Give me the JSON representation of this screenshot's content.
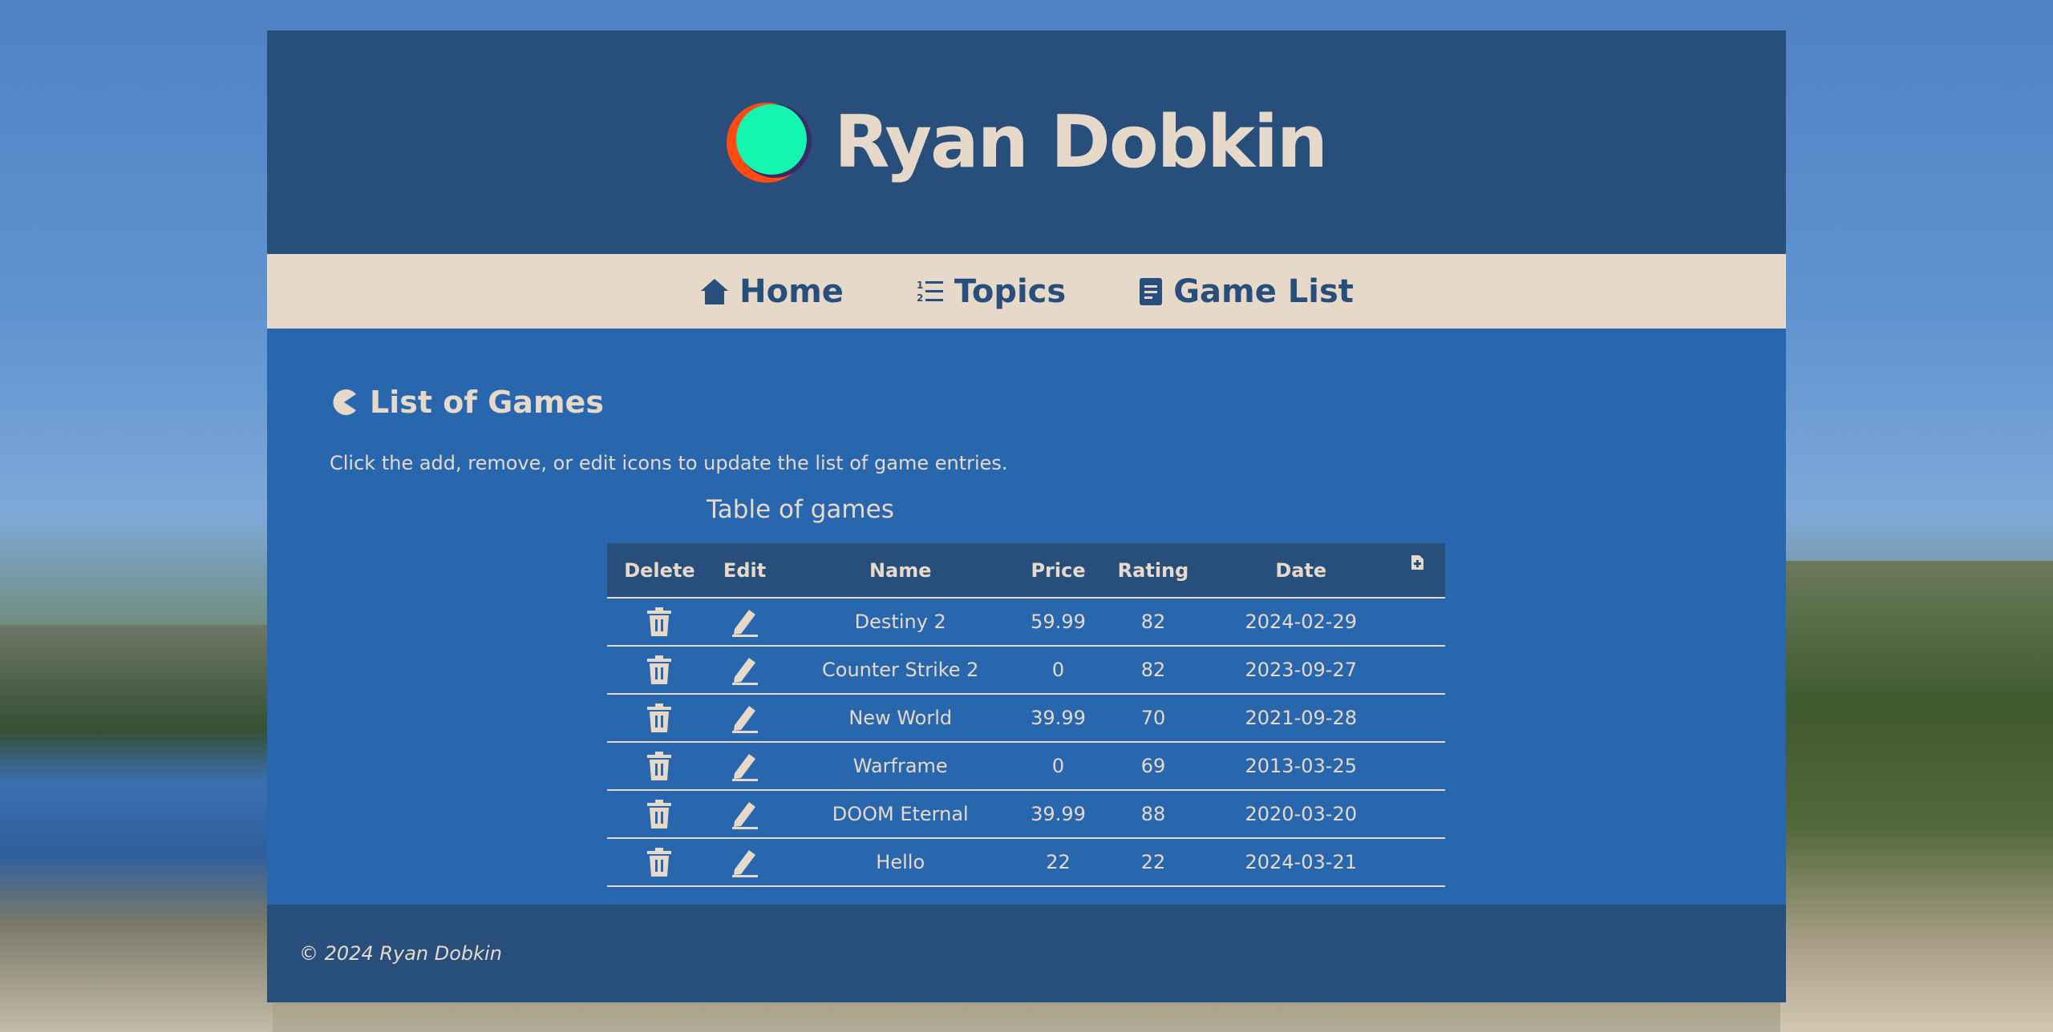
{
  "site": {
    "title": "Ryan Dobkin"
  },
  "nav": {
    "items": [
      {
        "label": "Home",
        "icon": "home-icon"
      },
      {
        "label": "Topics",
        "icon": "numbered-list-icon"
      },
      {
        "label": "Game List",
        "icon": "document-icon"
      }
    ]
  },
  "main": {
    "section_title": "List of Games",
    "intro": "Click the add, remove, or edit icons to update the list of game entries.",
    "table": {
      "caption": "Table of games",
      "headers": [
        "Delete",
        "Edit",
        "Name",
        "Price",
        "Rating",
        "Date"
      ],
      "add_icon": "add-file-icon",
      "rows": [
        {
          "name": "Destiny 2",
          "price": "59.99",
          "rating": "82",
          "date": "2024-02-29"
        },
        {
          "name": "Counter Strike 2",
          "price": "0",
          "rating": "82",
          "date": "2023-09-27"
        },
        {
          "name": "New World",
          "price": "39.99",
          "rating": "70",
          "date": "2021-09-28"
        },
        {
          "name": "Warframe",
          "price": "0",
          "rating": "69",
          "date": "2013-03-25"
        },
        {
          "name": "DOOM Eternal",
          "price": "39.99",
          "rating": "88",
          "date": "2020-03-20"
        },
        {
          "name": "Hello",
          "price": "22",
          "rating": "22",
          "date": "2024-03-21"
        }
      ]
    }
  },
  "footer": {
    "copyright": "© 2024 Ryan Dobkin"
  },
  "colors": {
    "header_bg": "#284f7b",
    "nav_bg": "#e6d9c9",
    "main_bg": "#2867ad",
    "text": "#e6d9c9",
    "logo_outer": "#ff4a12",
    "logo_inner": "#14f5b0"
  }
}
